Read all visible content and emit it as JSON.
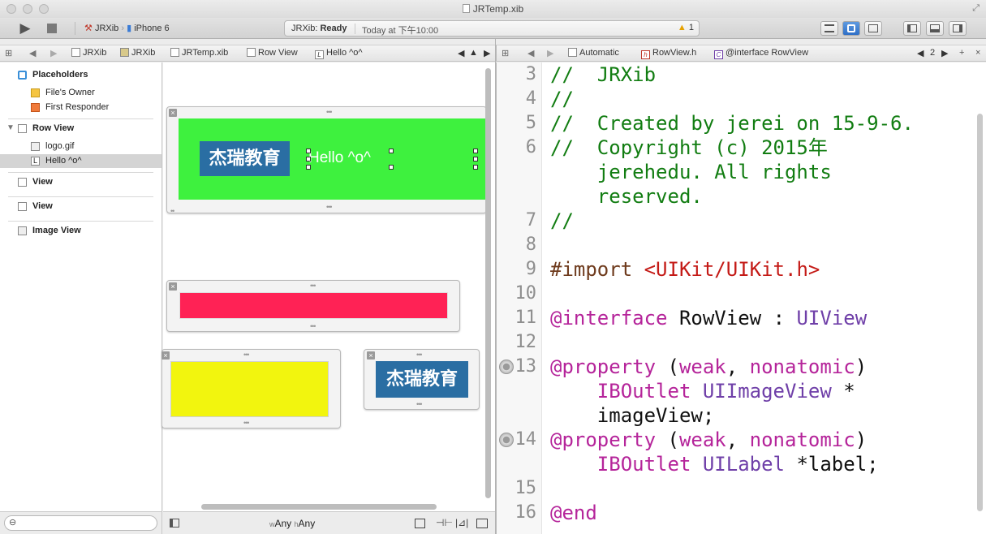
{
  "window": {
    "title": "JRTemp.xib"
  },
  "toolbar": {
    "scheme": "JRXib",
    "device": "iPhone 6",
    "status_app": "JRXib:",
    "status_state": "Ready",
    "status_time": "Today at 下午10:00",
    "warning_count": "1"
  },
  "ib_jumpbar": {
    "items": [
      "JRXib",
      "JRXib",
      "JRTemp.xib",
      "Row View",
      "Hello ^o^"
    ]
  },
  "editor_jumpbar": {
    "mode": "Automatic",
    "file": "RowView.h",
    "symbol": "@interface RowView",
    "counter": "2"
  },
  "outline": {
    "placeholders_header": "Placeholders",
    "files_owner": "File's Owner",
    "first_responder": "First Responder",
    "row_view": "Row View",
    "logo_item": "logo.gif",
    "label_item": "Hello ^o^",
    "view1": "View",
    "view2": "View",
    "image_view": "Image View"
  },
  "canvas": {
    "logo_text": "杰瑞教育",
    "label_text": "Hello ^o^",
    "size_class_w_prefix": "w",
    "size_class_w": "Any",
    "size_class_h_prefix": "h",
    "size_class_h": "Any",
    "colors": {
      "row_view_bg": "#3ef13e",
      "red_view_bg": "#ff2255",
      "yellow_view_bg": "#f2f50e",
      "logo_bg": "#2a6ea3"
    }
  },
  "code": {
    "lines": [
      {
        "n": "3",
        "text": "//  JRXib"
      },
      {
        "n": "4",
        "text": "//"
      },
      {
        "n": "5",
        "text": "//  Created by jerei on 15-9-6."
      },
      {
        "n": "6",
        "text": "//  Copyright (c) 2015年"
      },
      {
        "n": "",
        "text": "    jerehedu. All rights"
      },
      {
        "n": "",
        "text": "    reserved."
      },
      {
        "n": "7",
        "text": "//"
      },
      {
        "n": "8",
        "text": ""
      },
      {
        "n": "9",
        "kw": "#import",
        "str": "<UIKit/UIKit.h>"
      },
      {
        "n": "10",
        "text": ""
      },
      {
        "n": "11",
        "kw": "@interface",
        "name": "RowView",
        "sep": ":",
        "super": "UIView"
      },
      {
        "n": "12",
        "text": ""
      },
      {
        "n": "13",
        "kw": "@property",
        "attrs_open": "(",
        "a1": "weak",
        "comma": ",",
        "a2": "nonatomic",
        "attrs_close": ")"
      },
      {
        "n": "",
        "outlet": "IBOutlet",
        "type": "UIImageView",
        "star": "*"
      },
      {
        "n": "",
        "var": "imageView;"
      },
      {
        "n": "14",
        "kw": "@property",
        "attrs_open": "(",
        "a1": "weak",
        "comma": ",",
        "a2": "nonatomic",
        "attrs_close": ")"
      },
      {
        "n": "",
        "outlet": "IBOutlet",
        "type": "UILabel",
        "var": "*label;"
      },
      {
        "n": "15",
        "text": ""
      },
      {
        "n": "16",
        "kw": "@end"
      }
    ]
  }
}
